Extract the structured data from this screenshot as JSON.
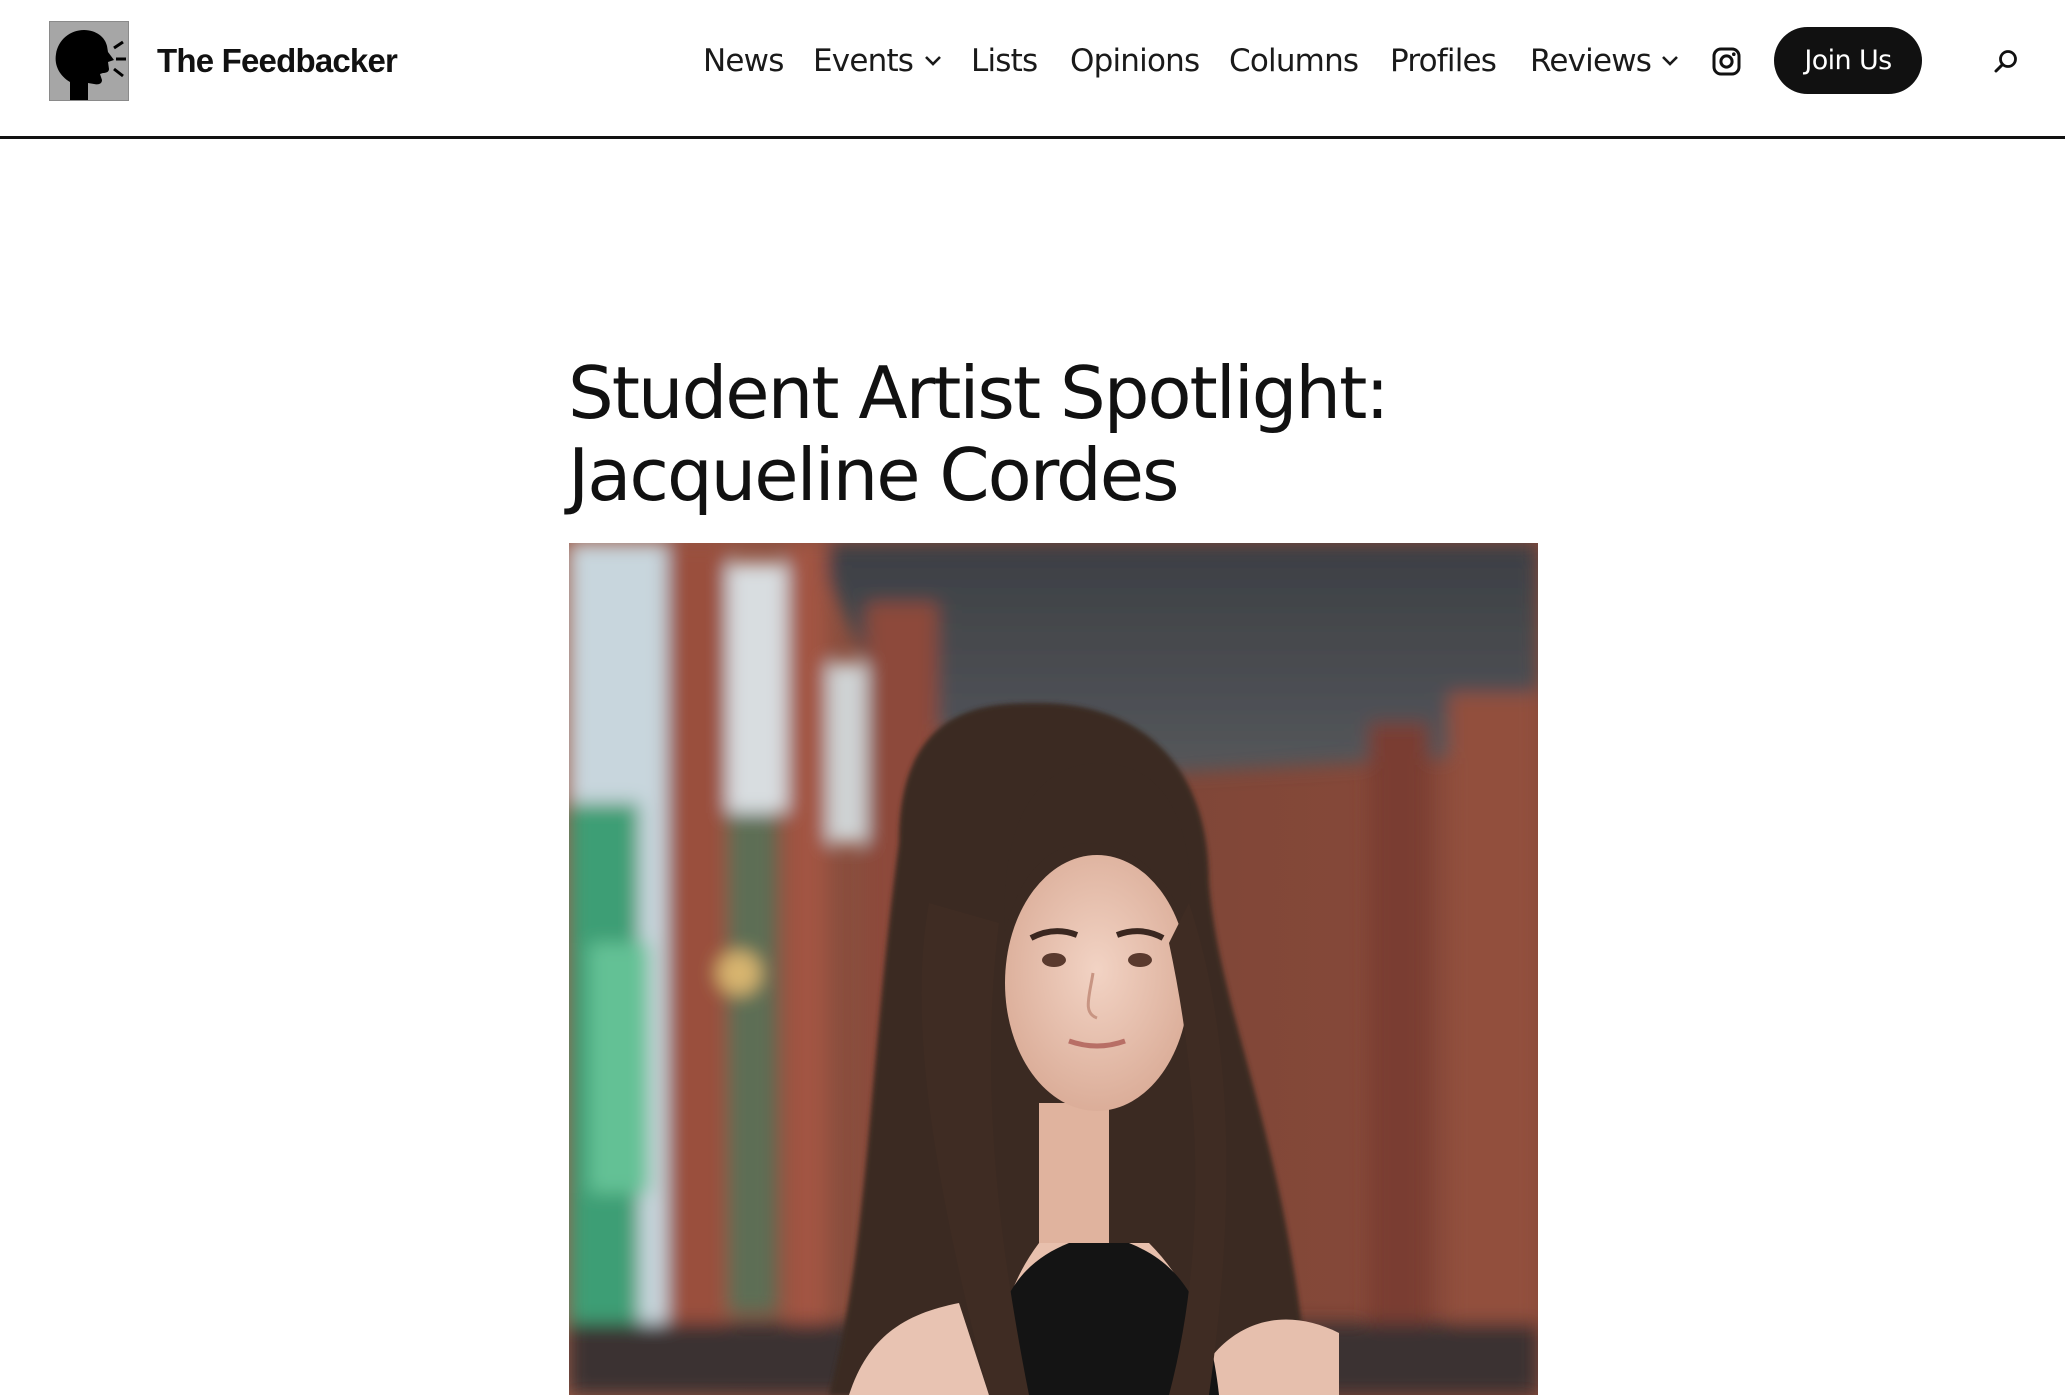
{
  "header": {
    "site_title": "The Feedbacker",
    "logo_icon": "speaking-head-icon"
  },
  "nav": {
    "items": [
      {
        "label": "News"
      },
      {
        "label": "Events",
        "dropdown": true
      },
      {
        "label": "Lists"
      },
      {
        "label": "Opinions"
      },
      {
        "label": "Columns"
      },
      {
        "label": "Profiles"
      },
      {
        "label": "Reviews",
        "dropdown": true
      }
    ],
    "social_icon": "instagram-icon",
    "join_label": "Join Us",
    "search_icon": "search-icon"
  },
  "article": {
    "title_line1": "Student Artist Spotlight:",
    "title_line2": "Jacqueline Cordes",
    "hero_image": "portrait-photo"
  },
  "colors": {
    "text": "#111111",
    "button_bg": "#111111",
    "button_text": "#ffffff",
    "background": "#ffffff"
  }
}
